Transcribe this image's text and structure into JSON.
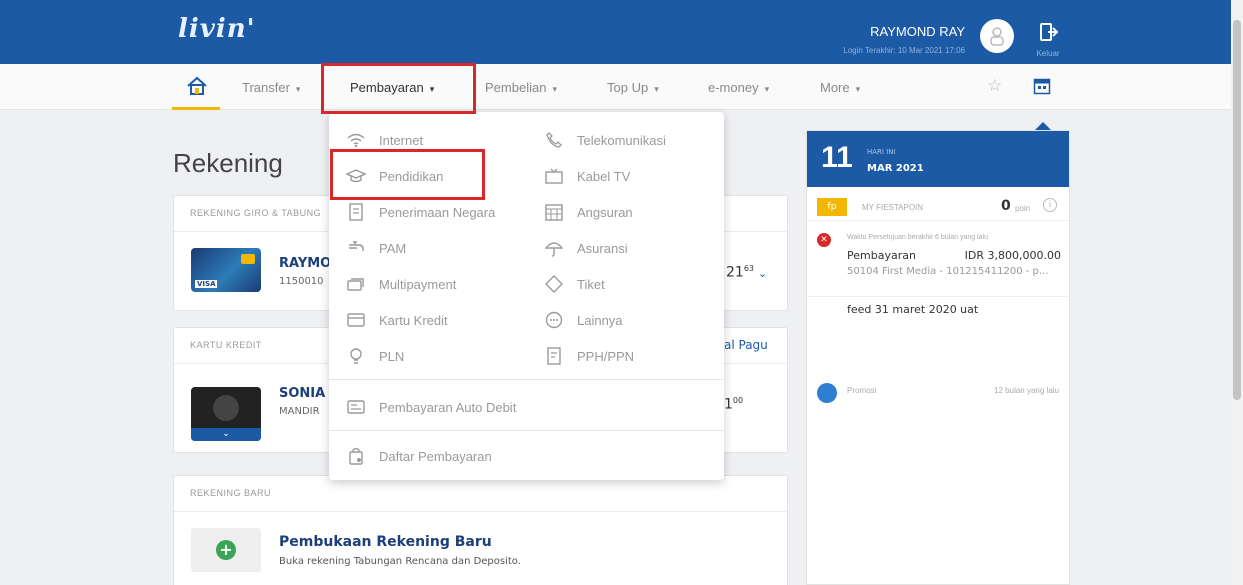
{
  "header": {
    "logo": "livin'",
    "user_name": "RAYMOND RAY",
    "last_login": "Login Terakhir: 10 Mar 2021 17:06",
    "logout_label": "Keluar",
    "brand_color": "#1c5aa6"
  },
  "nav": {
    "items": [
      {
        "label": "Transfer"
      },
      {
        "label": "Pembayaran"
      },
      {
        "label": "Pembelian"
      },
      {
        "label": "Top Up"
      },
      {
        "label": "e-money"
      },
      {
        "label": "More"
      }
    ]
  },
  "main": {
    "title": "Rekening",
    "giro_header": "REKENING GIRO & TABUNG",
    "account1_name": "RAYMO",
    "account1_number": "1150010",
    "account1_balance": "21",
    "account1_cents": "63",
    "credit_header": "KARTU KREDIT",
    "credit_link": "al Pagu",
    "account2_name": "SONIA",
    "account2_bank": "MANDIR",
    "account2_balance": "1",
    "account2_cents": "00",
    "new_header": "REKENING BARU",
    "new_title": "Pembukaan Rekening Baru",
    "new_desc": "Buka rekening Tabungan Rencana dan Deposito."
  },
  "dropdown": {
    "left": [
      "Internet",
      "Pendidikan",
      "Penerimaan Negara",
      "PAM",
      "Multipayment",
      "Kartu Kredit",
      "PLN"
    ],
    "right": [
      "Telekomunikasi",
      "Kabel TV",
      "Angsuran",
      "Asuransi",
      "Tiket",
      "Lainnya",
      "PPH/PPN"
    ],
    "auto_debit": "Pembayaran Auto Debit",
    "list": "Daftar Pembayaran"
  },
  "panel": {
    "day": "11",
    "today": "HARI INI",
    "month": "MAR 2021",
    "fiestapoin_label": "MY FIESTAPOIN",
    "fiestapoin_value": "0",
    "fiestapoin_unit": "poin",
    "notif1_meta": "Waktu Persetujuan berakhir 6 bulan yang lalu",
    "notif1_title": "Pembayaran",
    "notif1_amount": "IDR 3,800,000.00",
    "notif1_desc": "50104 First Media - 101215411200 - p...",
    "feed": "feed 31 maret 2020 uat",
    "promo_label": "Promosi",
    "promo_time": "12 bulan yang lalu"
  }
}
